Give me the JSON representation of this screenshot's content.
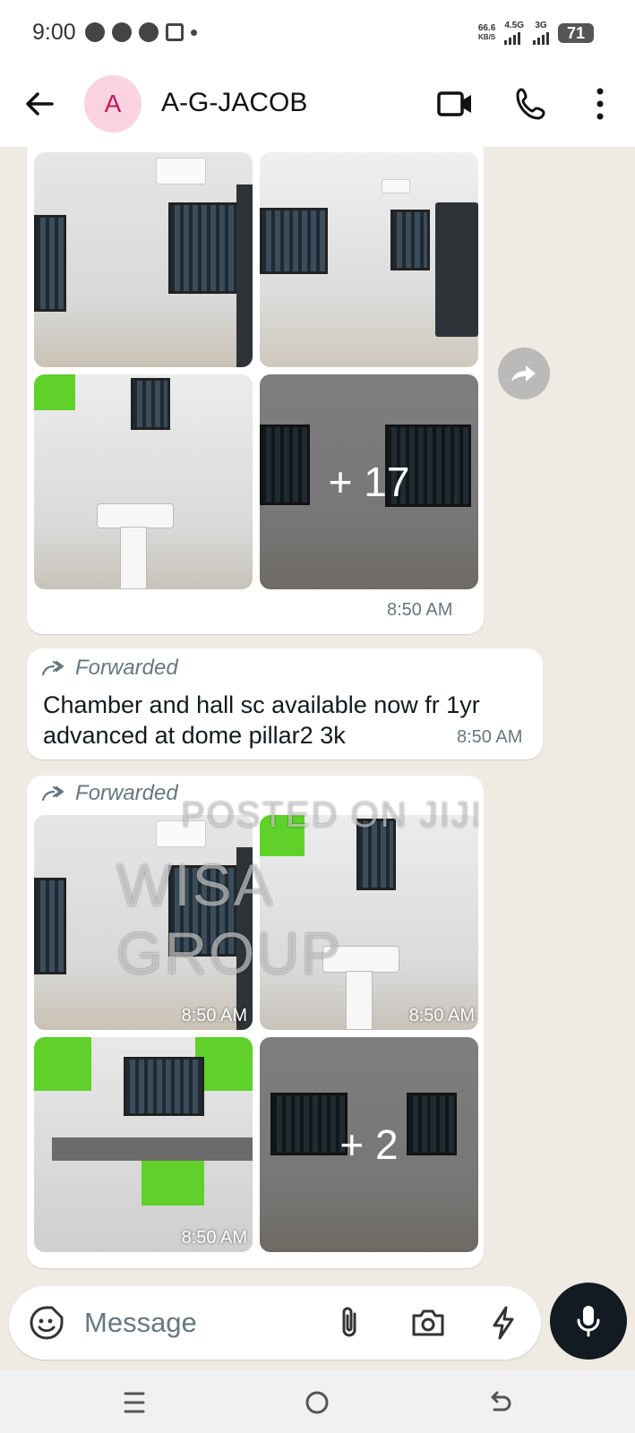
{
  "status_bar": {
    "time": "9:00",
    "net_speed_value": "66.6",
    "net_speed_unit": "KB/S",
    "sim1_label": "4.5G",
    "sim2_label": "3G",
    "battery": "71"
  },
  "header": {
    "avatar_letter": "A",
    "contact_name": "A-G-JACOB",
    "icons": [
      "back-arrow-icon",
      "video-call-icon",
      "phone-call-icon",
      "more-vert-icon"
    ]
  },
  "messages": [
    {
      "type": "album",
      "more_count": "+ 17",
      "time": "8:50 AM"
    },
    {
      "type": "text",
      "forwarded_label": "Forwarded",
      "text": "Chamber and hall sc available now fr 1yr advanced at dome pillar2 3k",
      "time": "8:50 AM"
    },
    {
      "type": "album",
      "forwarded_label": "Forwarded",
      "watermark_top": "POSTED ON JIJI",
      "watermark_main": "WISA GROUP",
      "photo_times": [
        "8:50 AM",
        "8:50 AM",
        "8:50 AM"
      ],
      "more_count": "+ 2"
    }
  ],
  "composer": {
    "placeholder": "Message",
    "icons": [
      "sticker-icon",
      "attach-icon",
      "camera-icon",
      "flash-icon",
      "mic-icon"
    ]
  },
  "colors": {
    "chat_bg": "#efeae2",
    "bubble_bg": "#ffffff",
    "timestamp": "#667781",
    "avatar_bg": "#fbd3e0",
    "avatar_fg": "#c2185b",
    "mic_bg": "#111b21"
  }
}
